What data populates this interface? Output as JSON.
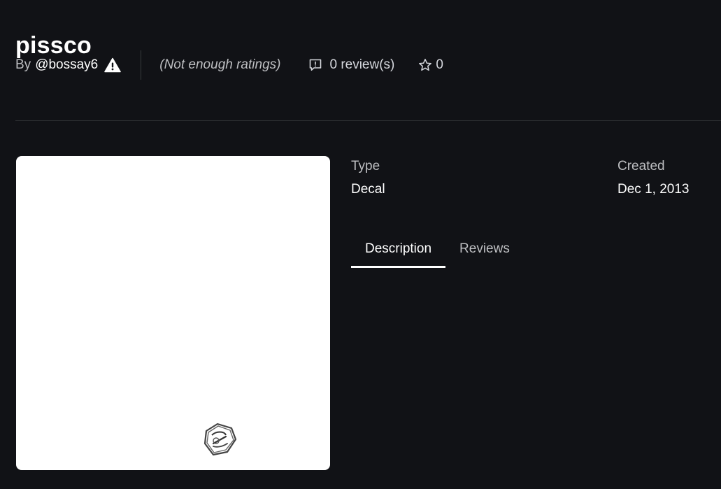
{
  "asset": {
    "title": "pissco",
    "by_label": "By",
    "creator": "@bossay6",
    "ratings_text": "(Not enough ratings)",
    "reviews_text": "0 review(s)",
    "favorites_count": "0"
  },
  "details": {
    "type_label": "Type",
    "type_value": "Decal",
    "created_label": "Created",
    "created_value": "Dec 1, 2013"
  },
  "tabs": [
    {
      "label": "Description",
      "active": true
    },
    {
      "label": "Reviews",
      "active": false
    }
  ],
  "icons": {
    "creator_badge": "warning-icon",
    "reviews": "review-comment-icon",
    "favorites": "star-icon"
  },
  "colors": {
    "background": "#111216",
    "text_primary": "#ffffff",
    "text_secondary": "#bdbec1",
    "divider": "#2f3134",
    "thumbnail_bg": "#ffffff"
  }
}
